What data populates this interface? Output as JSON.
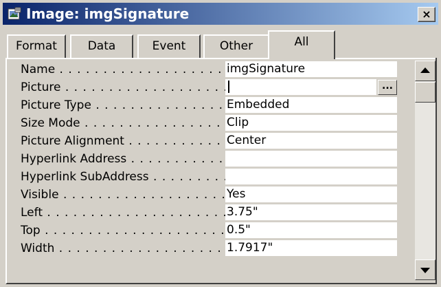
{
  "window": {
    "title": "Image: imgSignature",
    "close_label": "×",
    "icon": "image-properties-icon"
  },
  "tabs": [
    {
      "label": "Format",
      "active": false
    },
    {
      "label": "Data",
      "active": false
    },
    {
      "label": "Event",
      "active": false
    },
    {
      "label": "Other",
      "active": false
    },
    {
      "label": "All",
      "active": true
    }
  ],
  "properties": [
    {
      "label": "Name",
      "value": "imgSignature"
    },
    {
      "label": "Picture",
      "value": ""
    },
    {
      "label": "Picture Type",
      "value": "Embedded"
    },
    {
      "label": "Size Mode",
      "value": "Clip"
    },
    {
      "label": "Picture Alignment",
      "value": "Center"
    },
    {
      "label": "Hyperlink Address",
      "value": ""
    },
    {
      "label": "Hyperlink SubAddress",
      "value": ""
    },
    {
      "label": "Visible",
      "value": "Yes"
    },
    {
      "label": "Left",
      "value": "3.75\""
    },
    {
      "label": "Top",
      "value": "0.5\""
    },
    {
      "label": "Width",
      "value": "1.7917\""
    }
  ],
  "builder_button_label": "...",
  "dots": " . . . . . . . . . . . . . . . . . . . . . . . . . . . .",
  "scrollbar": {
    "up_icon": "scroll-up-arrow-icon",
    "down_icon": "scroll-down-arrow-icon"
  }
}
